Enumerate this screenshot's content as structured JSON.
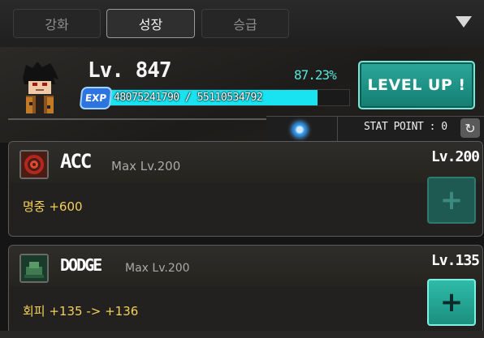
{
  "tabs": [
    {
      "label": "강화",
      "active": false
    },
    {
      "label": "성장",
      "active": true
    },
    {
      "label": "승급",
      "active": false
    }
  ],
  "header": {
    "level": "Lv. 847",
    "exp_percent_text": "87.23%",
    "exp_badge": "EXP",
    "exp_text": "48075241790 / 55110534792",
    "exp_fraction": 0.8723,
    "levelup_label": "LEVEL UP !",
    "stat_point_label": "STAT POINT : 0"
  },
  "stats": [
    {
      "name": "ACC",
      "max": "Max Lv.200",
      "level": "Lv.200",
      "effect": "명중 +600",
      "icon": "target-icon",
      "upgradable": false
    },
    {
      "name": "DODGE",
      "max": "Max Lv.200",
      "level": "Lv.135",
      "effect": "회피 +135 -> +136",
      "icon": "dodge-icon",
      "upgradable": true
    }
  ],
  "colors": {
    "accent": "#19e3f1",
    "button": "#1b8f80",
    "effect_text": "#f2d05a"
  }
}
